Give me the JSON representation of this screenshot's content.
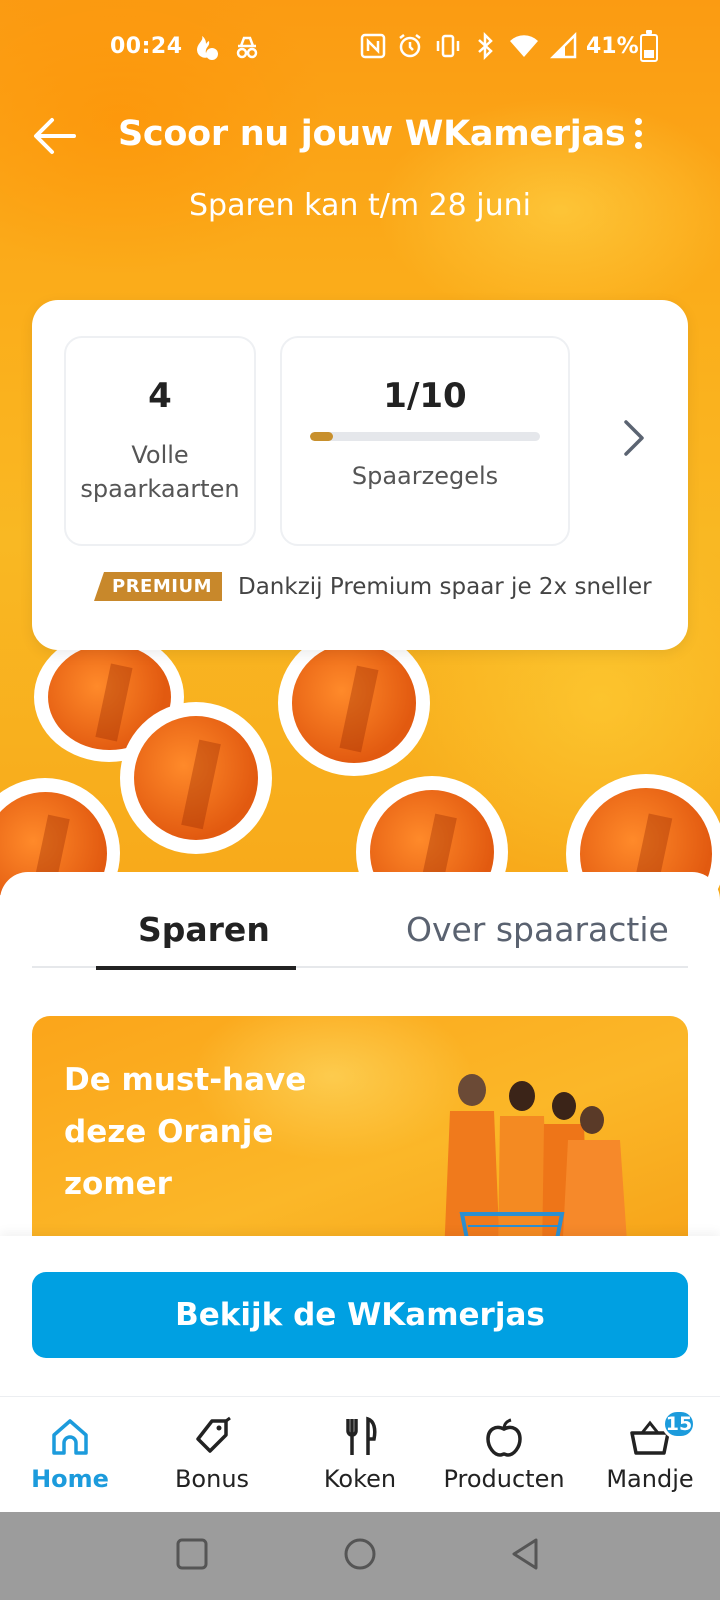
{
  "status_bar": {
    "time": "00:24",
    "battery_percent": "41%",
    "battery_level": 0.41,
    "icons": [
      "flame-alarm-icon",
      "incognito-icon",
      "nfc-icon",
      "alarm-icon",
      "vibrate-icon",
      "bluetooth-icon",
      "wifi-icon",
      "signal-icon",
      "battery-icon"
    ]
  },
  "header": {
    "title": "Scoor nu jouw WKamerjas",
    "subtitle": "Sparen kan t/m 28 juni",
    "back_icon": "arrow-left-icon",
    "more_icon": "more-vertical-icon"
  },
  "savings_card": {
    "full_cards_value": "4",
    "full_cards_label": "Volle spaarkaarten",
    "stamps_value": "1/10",
    "stamps_progress": 0.1,
    "stamps_label": "Spaarzegels",
    "premium_badge": "PREMIUM",
    "premium_text": "Dankzij Premium spaar je 2x sneller"
  },
  "stickers": {
    "label": "WKamerjas-zegel"
  },
  "tabs": [
    {
      "label": "Sparen",
      "active": true
    },
    {
      "label": "Over spaaractie",
      "active": false
    }
  ],
  "promo": {
    "text": "De must-have deze Oranje zomer"
  },
  "cta": {
    "label": "Bekijk de WKamerjas"
  },
  "bottom_nav": [
    {
      "label": "Home",
      "icon": "home-icon",
      "active": true
    },
    {
      "label": "Bonus",
      "icon": "tag-icon",
      "active": false
    },
    {
      "label": "Koken",
      "icon": "fork-knife-icon",
      "active": false
    },
    {
      "label": "Producten",
      "icon": "apple-icon",
      "active": false
    },
    {
      "label": "Mandje",
      "icon": "basket-icon",
      "active": false,
      "badge": "15"
    }
  ],
  "colors": {
    "accent_blue": "#00a0e2",
    "orange_bg": "#fbae1b",
    "premium_gold": "#c8882b"
  }
}
